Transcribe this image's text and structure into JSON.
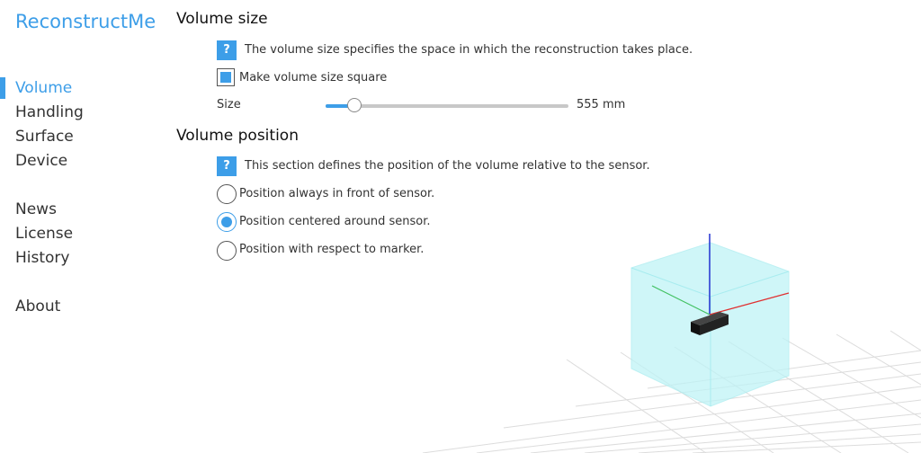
{
  "app": {
    "title": "ReconstructMe"
  },
  "nav": {
    "items": [
      "Volume",
      "Handling",
      "Surface",
      "Device",
      "News",
      "License",
      "History",
      "About"
    ],
    "active": "Volume"
  },
  "volume_size": {
    "title": "Volume size",
    "help_text": "The volume size specifies the space in which the reconstruction takes place.",
    "square_label": "Make volume size square",
    "square_checked": true,
    "size_label": "Size",
    "size_value": "555 mm",
    "slider_fraction": 0.12
  },
  "volume_position": {
    "title": "Volume position",
    "help_text": "This section defines the position of the volume relative to the sensor.",
    "options": [
      "Position always in front of sensor.",
      "Position centered around sensor.",
      "Position with respect to marker."
    ],
    "selected_index": 1
  },
  "help_glyph": "?",
  "colors": {
    "accent": "#3d9ee8",
    "volume_cube": "#bff3f6",
    "axis_x": "#e03030",
    "axis_y": "#40c060",
    "axis_z": "#2030d0"
  }
}
